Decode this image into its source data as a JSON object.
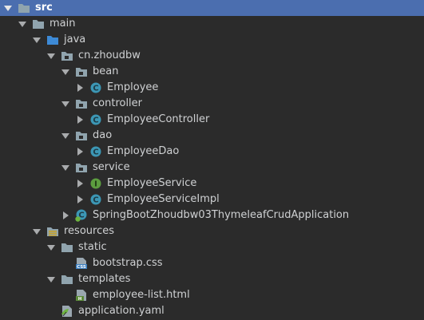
{
  "tree": {
    "src": "src",
    "main": "main",
    "java": "java",
    "package": "cn.zhoudbw",
    "bean": "bean",
    "employee": "Employee",
    "controller": "controller",
    "employee_controller": "EmployeeController",
    "dao": "dao",
    "employee_dao": "EmployeeDao",
    "service": "service",
    "employee_service": "EmployeeService",
    "employee_service_impl": "EmployeeServiceImpl",
    "application_class": "SpringBootZhoudbw03ThymeleafCrudApplication",
    "resources": "resources",
    "static": "static",
    "bootstrap_css": "bootstrap.css",
    "templates": "templates",
    "employee_list_html": "employee-list.html",
    "application_yaml": "application.yaml"
  },
  "colors": {
    "background": "#2b2b2b",
    "selection": "#4b6eaf",
    "text": "#cfd1d3",
    "folder": "#90a4ae",
    "source_folder": "#3d8ad6",
    "class_icon": "#3c97b5",
    "interface_icon": "#5c9e3f"
  },
  "icons": {
    "expanded": "triangle-down-icon",
    "collapsed": "triangle-right-icon",
    "folder": "folder-icon",
    "package": "package-icon",
    "class": "class-c-icon",
    "interface": "interface-i-icon",
    "spring_boot": "spring-boot-class-icon",
    "css_file": "css-file-icon",
    "html_file": "html-file-icon",
    "yaml_file": "yaml-file-icon"
  }
}
